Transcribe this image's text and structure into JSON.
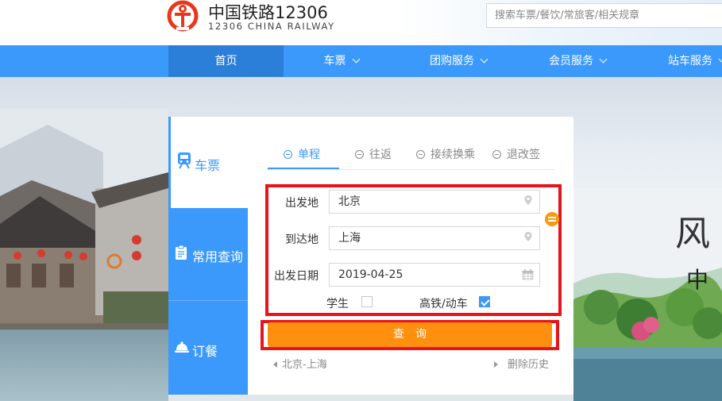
{
  "header": {
    "logo_cn": "中国铁路12306",
    "logo_en": "12306 CHINA RAILWAY",
    "search_placeholder": "搜索车票/餐饮/常旅客/相关规章"
  },
  "nav": {
    "items": [
      {
        "label": "首页",
        "active": true,
        "dropdown": false
      },
      {
        "label": "车票",
        "active": false,
        "dropdown": true
      },
      {
        "label": "团购服务",
        "active": false,
        "dropdown": true
      },
      {
        "label": "会员服务",
        "active": false,
        "dropdown": true
      },
      {
        "label": "站车服务",
        "active": false,
        "dropdown": true
      }
    ]
  },
  "side_tabs": [
    {
      "label": "车票",
      "icon": "train-icon",
      "active": true
    },
    {
      "label": "常用查询",
      "icon": "clipboard-icon",
      "active": false
    },
    {
      "label": "订餐",
      "icon": "food-cloche-icon",
      "active": false
    }
  ],
  "trip_tabs": [
    {
      "label": "单程",
      "active": true
    },
    {
      "label": "往返",
      "active": false
    },
    {
      "label": "接续换乘",
      "active": false
    },
    {
      "label": "退改签",
      "active": false
    }
  ],
  "form": {
    "from_label": "出发地",
    "from_value": "北京",
    "to_label": "到达地",
    "to_value": "上海",
    "date_label": "出发日期",
    "date_value": "2019-04-25",
    "student_label": "学生",
    "student_checked": false,
    "highspeed_label": "高铁/动车",
    "highspeed_checked": true,
    "query_button": "查　询"
  },
  "history": {
    "recent": "北京-上海",
    "delete_label": "删除历史"
  },
  "banner": {
    "title_char": "风",
    "sub_char": "中"
  },
  "colors": {
    "nav_blue": "#3b99fc",
    "nav_active": "#2b7fd9",
    "query_orange": "#ff8f0e",
    "highlight_red": "#e8141b",
    "logo_red": "#e8371e"
  }
}
